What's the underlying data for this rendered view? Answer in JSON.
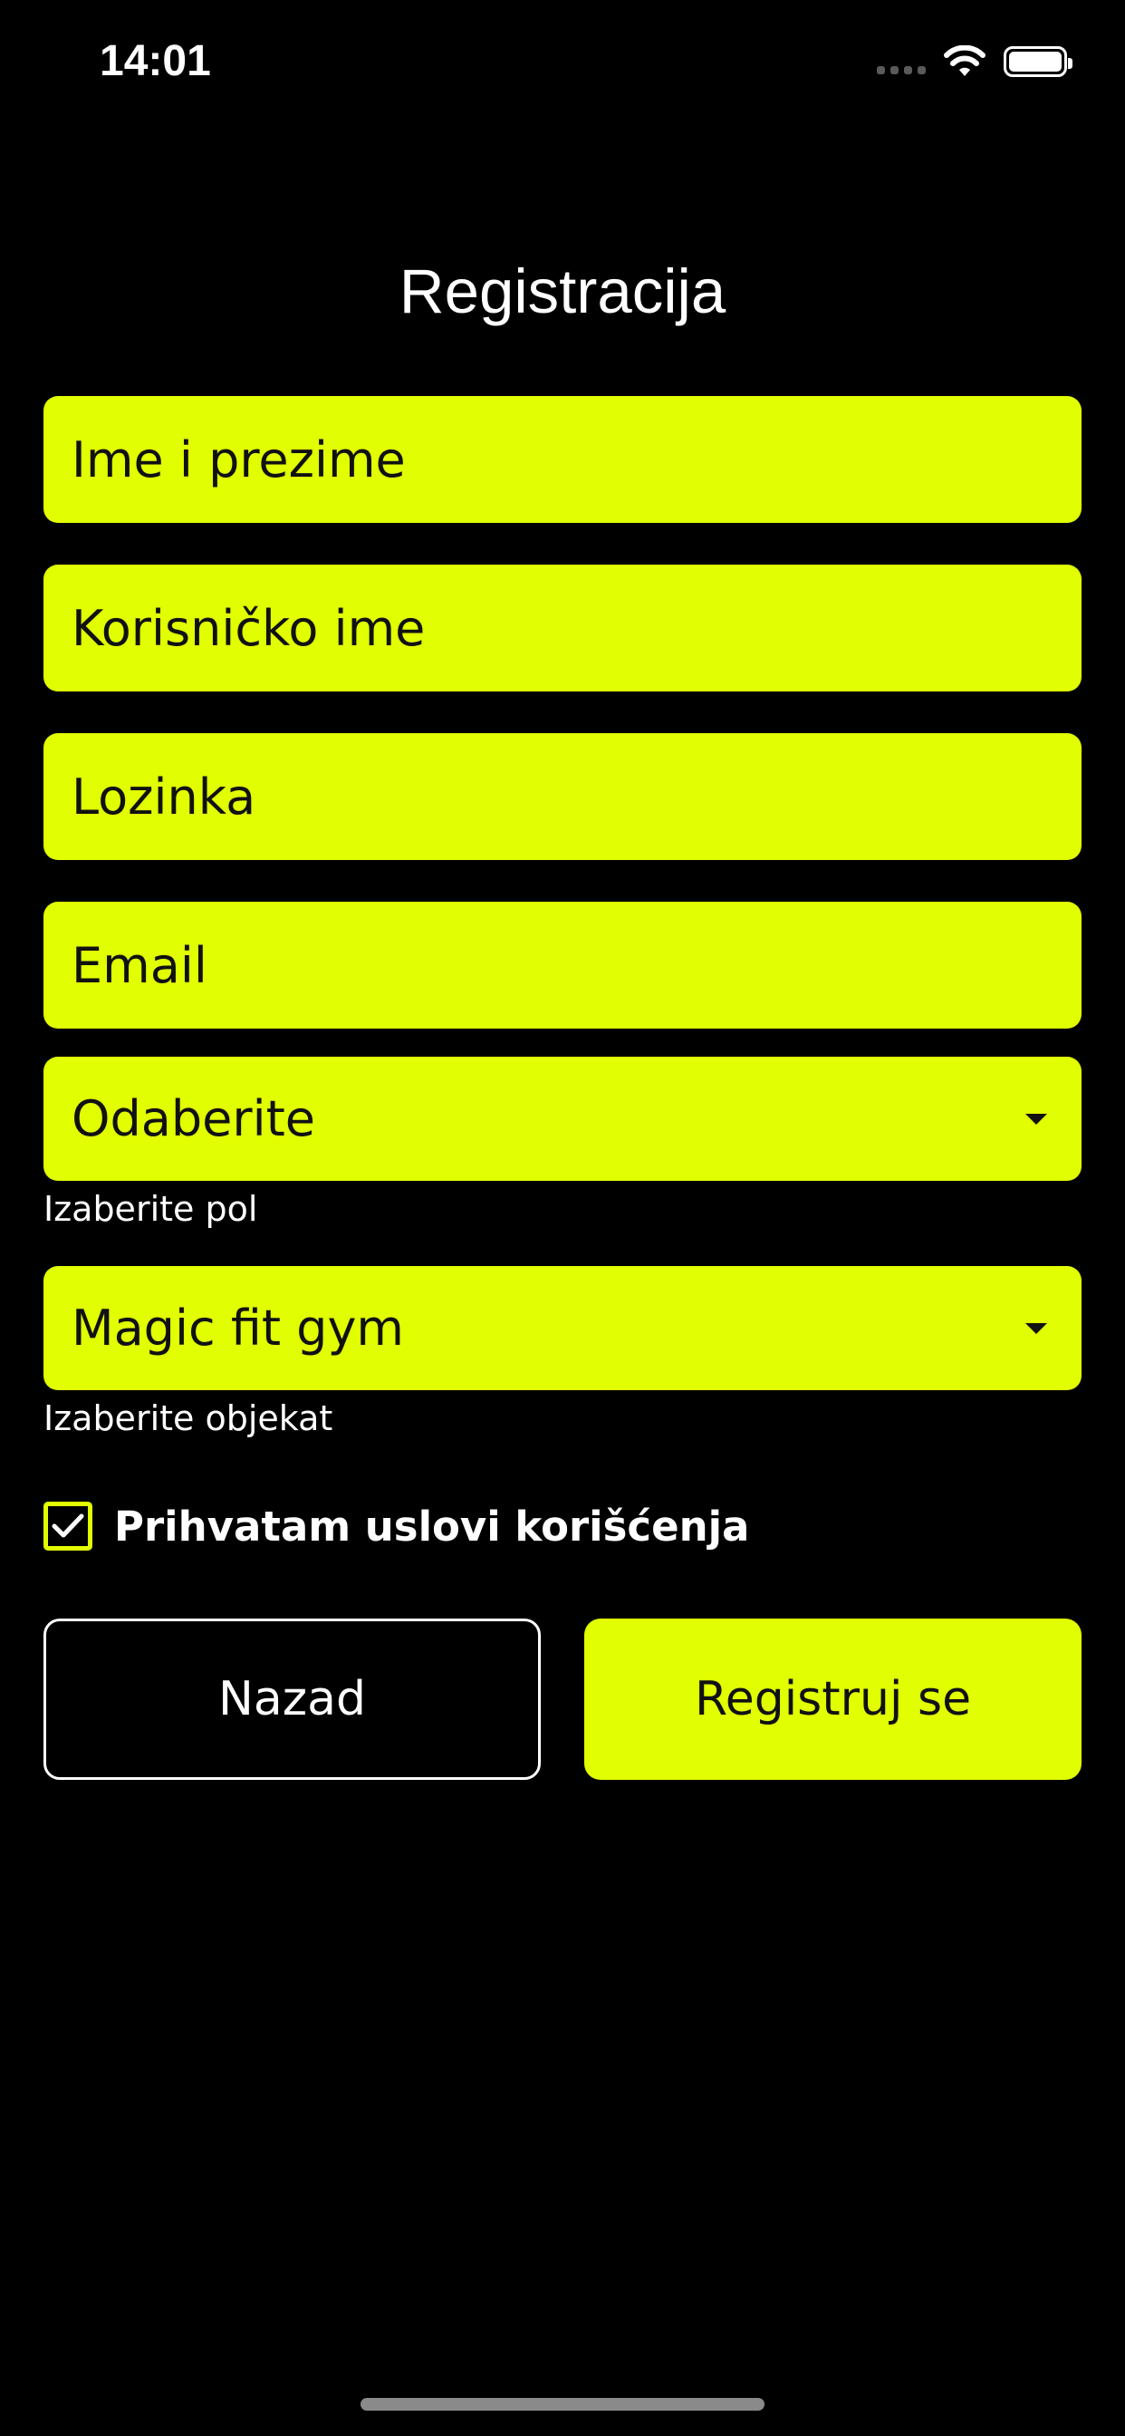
{
  "status_bar": {
    "time": "14:01",
    "icons": [
      "cellular-signal-icon",
      "wifi-icon",
      "battery-icon"
    ]
  },
  "title": "Registracija",
  "form": {
    "full_name_placeholder": "Ime i prezime",
    "username_placeholder": "Korisničko ime",
    "password_placeholder": "Lozinka",
    "email_placeholder": "Email",
    "gender_select": {
      "value": "Odaberite",
      "helper": "Izaberite pol"
    },
    "facility_select": {
      "value": "Magic fit gym",
      "helper": "Izaberite objekat"
    },
    "terms": {
      "label": "Prihvatam uslovi korišćenja",
      "checked": true
    }
  },
  "buttons": {
    "back_label": "Nazad",
    "register_label": "Registruj se"
  },
  "colors": {
    "accent": "#e1ff00",
    "background": "#000000",
    "text_on_accent": "#111111",
    "text": "#ffffff"
  }
}
